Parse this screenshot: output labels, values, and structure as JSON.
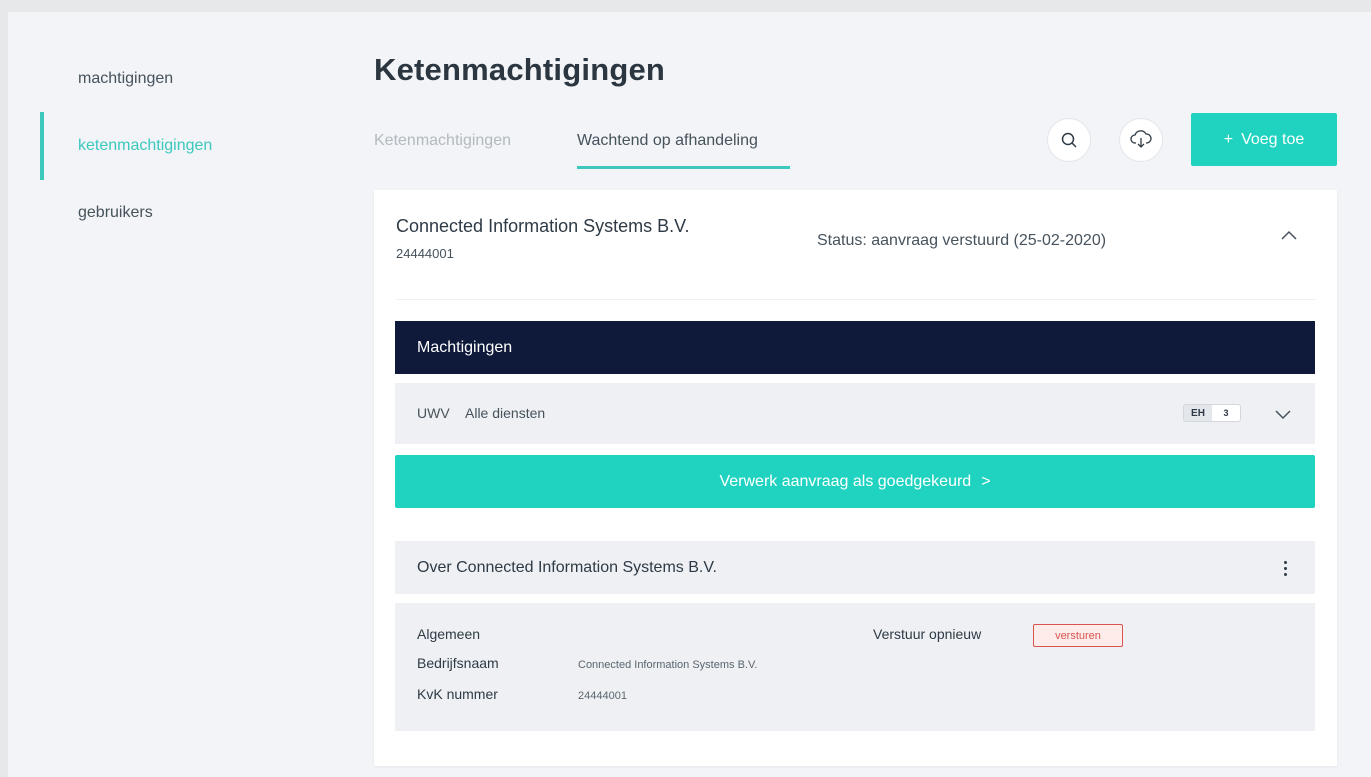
{
  "sidebar": {
    "items": [
      {
        "label": "machtigingen"
      },
      {
        "label": "ketenmachtigingen",
        "active": true
      },
      {
        "label": "gebruikers"
      }
    ]
  },
  "page": {
    "title": "Ketenmachtigingen"
  },
  "tabs": [
    {
      "label": "Ketenmachtigingen",
      "active": false
    },
    {
      "label": "Wachtend op afhandeling",
      "active": true
    }
  ],
  "toolbar": {
    "search_icon": "search-icon",
    "download_icon": "cloud-download-icon",
    "add_label": "Voeg toe",
    "add_prefix": "+"
  },
  "card": {
    "org_name": "Connected Information Systems B.V.",
    "org_id": "24444001",
    "status": "Status: aanvraag verstuurd (25-02-2020)",
    "section_title": "Machtigingen",
    "grant": {
      "org": "UWV",
      "service": "Alle diensten",
      "badge_key": "EH",
      "badge_value": "3"
    },
    "approve_label": "Verwerk aanvraag als goedgekeurd",
    "approve_suffix": ">",
    "about_title": "Over Connected Information Systems B.V.",
    "details": {
      "heading": "Algemeen",
      "company_label": "Bedrijfsnaam",
      "company_value": "Connected Information Systems B.V.",
      "kvk_label": "KvK nummer",
      "kvk_value": "24444001",
      "resend_label": "Verstuur opnieuw",
      "resend_button": "versturen"
    }
  },
  "colors": {
    "accent": "#20d3c1",
    "accent_text": "#3cc8bd",
    "header_dark": "#0f1a3b",
    "danger": "#d9534f"
  }
}
